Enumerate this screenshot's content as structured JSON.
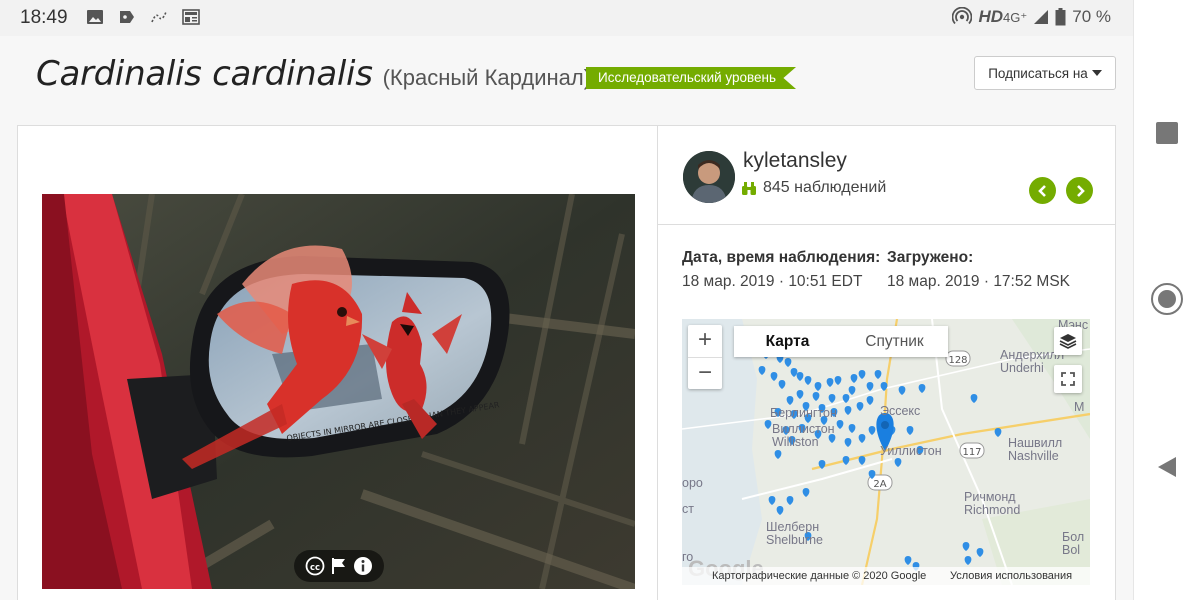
{
  "status_bar": {
    "time": "18:49",
    "network": "HD",
    "signal": "4G⁺",
    "battery": "70 %"
  },
  "header": {
    "scientific_name": "Cardinalis cardinalis",
    "common_name": "(Красный Кардинал)",
    "quality_grade": "Исследовательский уровень",
    "subscribe_label": "Подписаться на"
  },
  "observer": {
    "username": "kyletansley",
    "observations": "845 наблюдений"
  },
  "meta": {
    "observed_label": "Дата, время наблюдения:",
    "observed_value": "18 мар. 2019 · 10:51 EDT",
    "uploaded_label": "Загружено:",
    "uploaded_value": "18 мар. 2019 · 17:52 MSK"
  },
  "map": {
    "tab_map": "Карта",
    "tab_satellite": "Спутник",
    "zoom_in": "+",
    "zoom_out": "−",
    "attribution": "Картографические данные © 2020 Google",
    "terms": "Условия использования",
    "google_logo": "Google",
    "place_labels": [
      "Андерхилл Underhi",
      "Эссекс",
      "Берлингтон",
      "Виллистон Williston",
      "Уиллистон",
      "Нашвилл Nashville",
      "Ричмонд Richmond",
      "Шелберн Shelburne",
      "Бол Bol",
      "Мэнс",
      "M",
      "оро",
      "ст",
      "го"
    ],
    "route_labels": [
      "128",
      "117",
      "2A"
    ]
  },
  "photo": {
    "mirror_text": "OBJECTS IN MIRROR ARE CLOSER THAN THEY APPEAR"
  },
  "colors": {
    "brand_green": "#74ac00",
    "pin_blue": "#2f8ee5"
  }
}
